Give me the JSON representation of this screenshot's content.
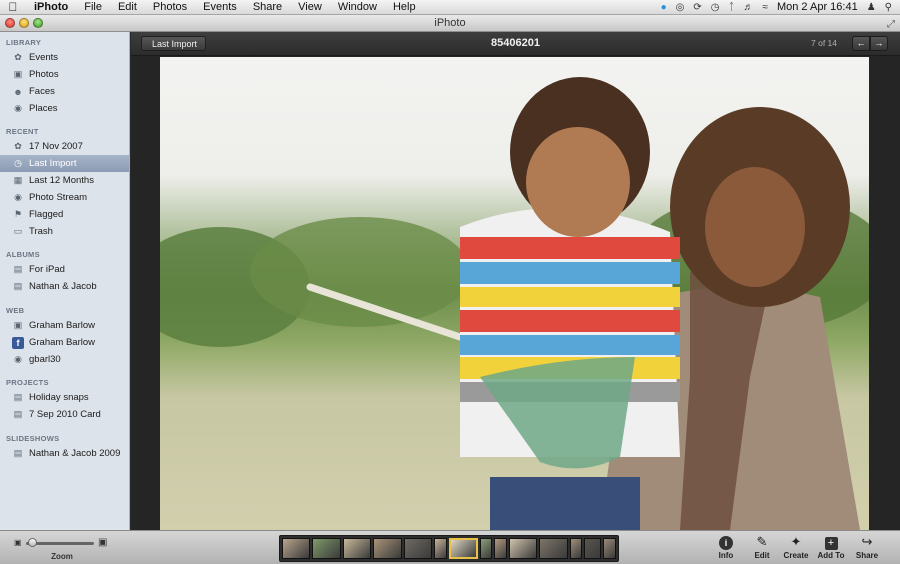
{
  "menubar": {
    "app": "iPhoto",
    "items": [
      "File",
      "Edit",
      "Photos",
      "Events",
      "Share",
      "View",
      "Window",
      "Help"
    ],
    "clock": "Mon 2 Apr  16:41",
    "status_icons": [
      "twitter-icon",
      "globe-icon",
      "sync-icon",
      "time-machine-icon",
      "bluetooth-icon",
      "volume-icon",
      "wifi-icon",
      "user-icon",
      "spotlight-icon"
    ]
  },
  "window": {
    "title": "iPhoto"
  },
  "sidebar": {
    "sections": [
      {
        "label": "LIBRARY",
        "items": [
          {
            "label": "Events",
            "icon": "events-icon"
          },
          {
            "label": "Photos",
            "icon": "photos-icon"
          },
          {
            "label": "Faces",
            "icon": "faces-icon"
          },
          {
            "label": "Places",
            "icon": "places-icon"
          }
        ]
      },
      {
        "label": "RECENT",
        "items": [
          {
            "label": "17 Nov 2007",
            "icon": "event-icon"
          },
          {
            "label": "Last Import",
            "icon": "clock-icon",
            "selected": true
          },
          {
            "label": "Last 12 Months",
            "icon": "calendar-icon"
          },
          {
            "label": "Photo Stream",
            "icon": "photo-stream-icon"
          },
          {
            "label": "Flagged",
            "icon": "flag-icon"
          },
          {
            "label": "Trash",
            "icon": "trash-icon"
          }
        ]
      },
      {
        "label": "ALBUMS",
        "items": [
          {
            "label": "For iPad",
            "icon": "album-icon"
          },
          {
            "label": "Nathan & Jacob",
            "icon": "album-icon"
          }
        ]
      },
      {
        "label": "WEB",
        "items": [
          {
            "label": "Graham Barlow",
            "icon": "web-album-icon"
          },
          {
            "label": "Graham Barlow",
            "icon": "facebook-icon"
          },
          {
            "label": "gbarl30",
            "icon": "flickr-icon"
          }
        ]
      },
      {
        "label": "PROJECTS",
        "items": [
          {
            "label": "Holiday snaps",
            "icon": "book-icon"
          },
          {
            "label": "7 Sep 2010 Card",
            "icon": "card-icon"
          }
        ]
      },
      {
        "label": "SLIDESHOWS",
        "items": [
          {
            "label": "Nathan & Jacob 2009",
            "icon": "slideshow-icon"
          }
        ]
      }
    ]
  },
  "header": {
    "back_label": "Last Import",
    "photo_title": "85406201",
    "counter": "7 of 14",
    "prev_symbol": "←",
    "next_symbol": "→"
  },
  "toolbar": {
    "zoom_label": "Zoom",
    "zoom_level": 0.05,
    "tools": [
      {
        "label": "Info",
        "icon": "info-icon",
        "glyph": "i"
      },
      {
        "label": "Edit",
        "icon": "pencil-icon",
        "glyph": "✎"
      },
      {
        "label": "Create",
        "icon": "create-icon",
        "glyph": "✦"
      },
      {
        "label": "Add To",
        "icon": "add-icon",
        "glyph": "+"
      },
      {
        "label": "Share",
        "icon": "share-icon",
        "glyph": "↪"
      }
    ]
  },
  "filmstrip": {
    "count": 14,
    "current_index": 6,
    "colors": [
      "#b9a48c",
      "#7f9a6a",
      "#c9b89a",
      "#a99478",
      "#6f6a62",
      "#c7b39a",
      "#e0d7c3",
      "#8c9f7a",
      "#b29a80",
      "#d0c3ad",
      "#7d7468",
      "#a08e7a",
      "#5a554e",
      "#9a8a78"
    ]
  },
  "colors": {
    "sidebar_bg": "#dde3ea",
    "selection": "#8b9bb3",
    "viewer_bg": "#252525",
    "current_thumb": "#e6c246"
  }
}
